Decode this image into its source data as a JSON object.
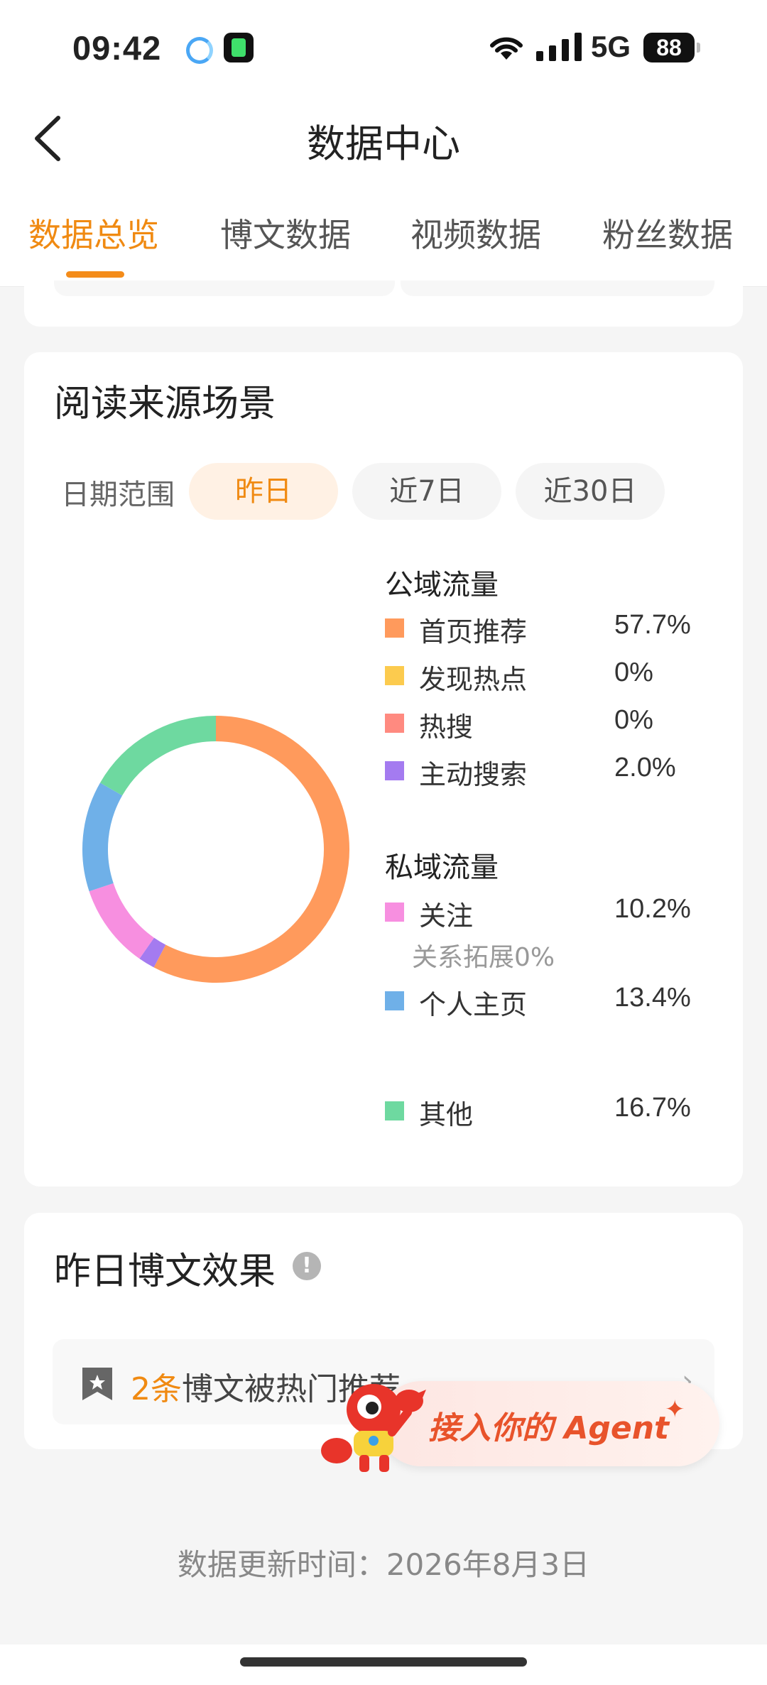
{
  "status_bar": {
    "time": "09:42",
    "network": "5G",
    "battery": "88"
  },
  "header": {
    "title": "数据中心"
  },
  "tabs": [
    {
      "label": "数据总览",
      "active": true
    },
    {
      "label": "博文数据",
      "active": false
    },
    {
      "label": "视频数据",
      "active": false
    },
    {
      "label": "粉丝数据",
      "active": false
    }
  ],
  "source_card": {
    "title": "阅读来源场景",
    "date_range_label": "日期范围",
    "ranges": [
      "昨日",
      "近7日",
      "近30日"
    ],
    "selected_range": "昨日",
    "public_title": "公域流量",
    "private_title": "私域流量",
    "public_items": [
      {
        "label": "首页推荐",
        "value": "57.7%",
        "color": "#FF9A5C"
      },
      {
        "label": "发现热点",
        "value": "0%",
        "color": "#FCCB4E"
      },
      {
        "label": "热搜",
        "value": "0%",
        "color": "#FF8A80"
      },
      {
        "label": "主动搜索",
        "value": "2.0%",
        "color": "#A47BF0"
      }
    ],
    "private_items": [
      {
        "label": "关注",
        "value": "10.2%",
        "color": "#F78FE0",
        "sub": "关系拓展0%"
      },
      {
        "label": "个人主页",
        "value": "13.4%",
        "color": "#6FB0E8"
      },
      {
        "label": "其他",
        "value": "16.7%",
        "color": "#6ED9A0"
      }
    ]
  },
  "chart_data": {
    "type": "pie",
    "categories": [
      "首页推荐",
      "发现热点",
      "热搜",
      "主动搜索",
      "关注",
      "个人主页",
      "其他"
    ],
    "values": [
      57.7,
      0,
      0,
      2.0,
      10.2,
      13.4,
      16.7
    ],
    "colors": [
      "#FF9A5C",
      "#FCCB4E",
      "#FF8A80",
      "#A47BF0",
      "#F78FE0",
      "#6FB0E8",
      "#6ED9A0"
    ],
    "donut": true
  },
  "blog_card": {
    "title": "昨日博文效果",
    "info_icon": "!",
    "count": "2条",
    "text": "博文被热门推荐",
    "arrow": "›"
  },
  "agent_banner": {
    "text": "接入你的 Agent",
    "star": "✦"
  },
  "footer": {
    "update_text": "数据更新时间：2026年8月3日"
  }
}
